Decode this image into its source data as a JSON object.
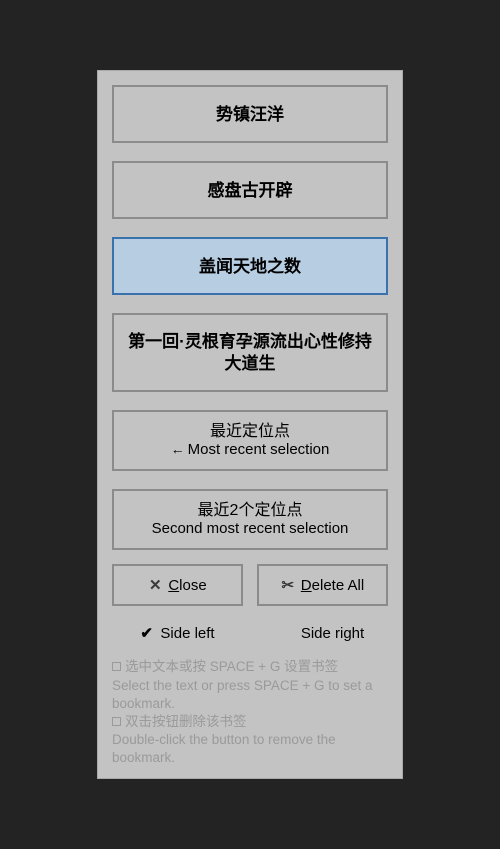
{
  "bookmarks": [
    {
      "label": "势镇汪洋"
    },
    {
      "label": "感盘古开辟"
    },
    {
      "label": "盖闻天地之数"
    },
    {
      "label": "第一回·灵根育孕源流出心性修持大道生"
    }
  ],
  "selectedIndex": 2,
  "recent": [
    {
      "title": "最近定位点",
      "arrow": "←",
      "sub": "Most recent selection"
    },
    {
      "title": "最近2个定位点",
      "arrow": "",
      "sub": "Second most recent selection"
    }
  ],
  "buttons": {
    "close": {
      "label_pre": "",
      "label_u": "C",
      "label_post": "lose"
    },
    "deleteAll": {
      "label_pre": "",
      "label_u": "D",
      "label_post": "elete All"
    }
  },
  "side": {
    "left": "Side left",
    "right": "Side right",
    "selected": "left"
  },
  "hints": {
    "h1_cn": "选中文本或按 SPACE + G 设置书签",
    "h1_en": "Select the text or press SPACE + G to set a bookmark.",
    "h2_cn": "双击按钮删除该书签",
    "h2_en": "Double-click the button to remove the bookmark."
  }
}
